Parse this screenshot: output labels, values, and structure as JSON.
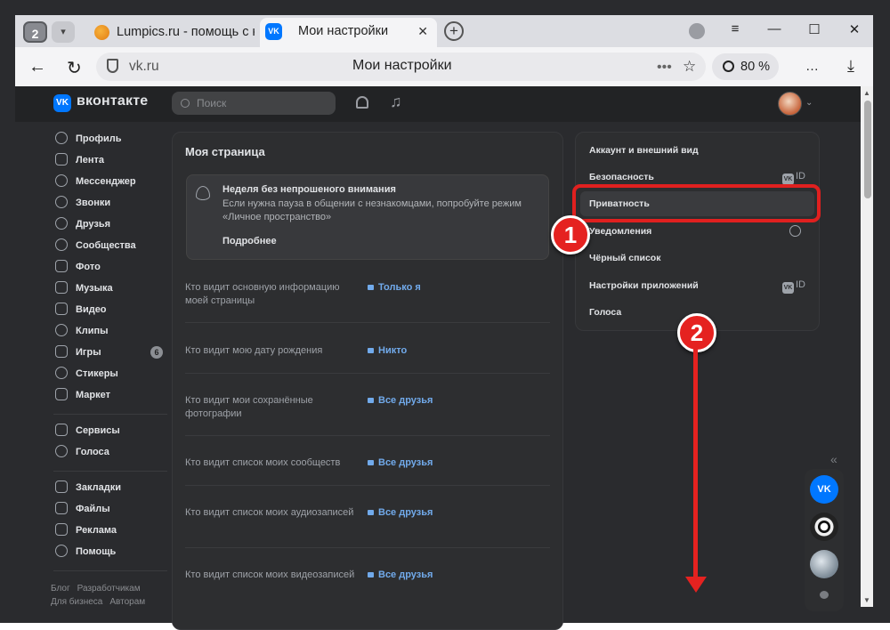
{
  "browser": {
    "tab_count": "2",
    "tabs": [
      {
        "title": "Lumpics.ru - помощь с ко"
      },
      {
        "title": "Мои настройки"
      }
    ],
    "address": "vk.ru",
    "page_title": "Мои настройки",
    "zoom": "80 %",
    "window_controls": [
      "≡",
      "—",
      "☐",
      "✕"
    ]
  },
  "vk": {
    "brand": "вконтакте",
    "search_placeholder": "Поиск",
    "sidebar": {
      "items": [
        "Профиль",
        "Лента",
        "Мессенджер",
        "Звонки",
        "Друзья",
        "Сообщества",
        "Фото",
        "Музыка",
        "Видео",
        "Клипы",
        "Игры",
        "Стикеры",
        "Маркет"
      ],
      "games_badge": "6",
      "items2": [
        "Сервисы",
        "Голоса"
      ],
      "items3": [
        "Закладки",
        "Файлы",
        "Реклама",
        "Помощь"
      ],
      "footer": [
        "Блог",
        "Разработчикам",
        "Для бизнеса",
        "Авторам"
      ]
    },
    "main": {
      "title": "Моя страница",
      "promo": {
        "title": "Неделя без непрошеного внимания",
        "text": "Если нужна пауза в общении с незнакомцами, попробуйте режим «Личное пространство»",
        "link": "Подробнее"
      },
      "rows": [
        {
          "q": "Кто видит основную информацию моей страницы",
          "v": "Только я"
        },
        {
          "q": "Кто видит мою дату рождения",
          "v": "Никто"
        },
        {
          "q": "Кто видит мои сохранённые фотографии",
          "v": "Все друзья"
        },
        {
          "q": "Кто видит список моих сообществ",
          "v": "Все друзья"
        },
        {
          "q": "Кто видит список моих аудиозаписей",
          "v": "Все друзья"
        },
        {
          "q": "Кто видит список моих видеозаписей",
          "v": "Все друзья"
        }
      ]
    },
    "settings_menu": {
      "items": [
        "Аккаунт и внешний вид",
        "Безопасность",
        "Приватность",
        "Уведомления",
        "Чёрный список",
        "Настройки приложений",
        "Голоса"
      ],
      "active": "Приватность",
      "id_tag": "ID"
    }
  },
  "annotations": {
    "markers": [
      "1",
      "2"
    ]
  },
  "colors": {
    "accent_red": "#e52220",
    "vk_blue": "#0077ff",
    "link_blue": "#71aaeb"
  }
}
